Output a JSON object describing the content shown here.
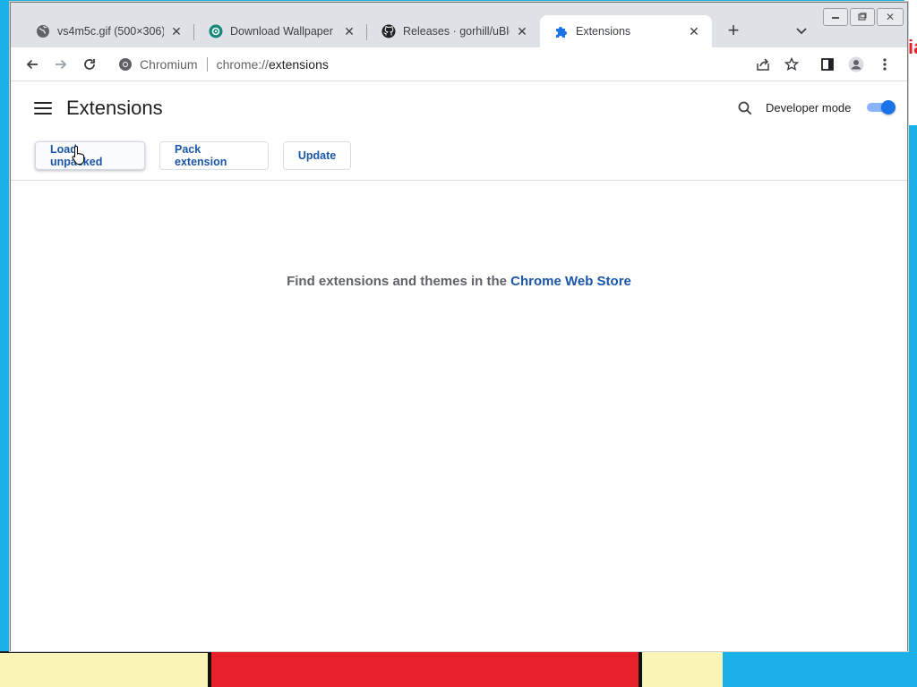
{
  "tabs": [
    {
      "title": "vs4m5c.gif (500×306)",
      "icon": "globe-icon"
    },
    {
      "title": "Download Wallpaper Engine",
      "icon": "wallpaper-engine-icon"
    },
    {
      "title": "Releases · gorhill/uBlock",
      "icon": "github-icon"
    },
    {
      "title": "Extensions",
      "icon": "puzzle-icon",
      "active": true
    }
  ],
  "omnibox": {
    "site_label": "Chromium",
    "url_scheme": "chrome://",
    "url_path": "extensions"
  },
  "page": {
    "title": "Extensions",
    "developer_mode_label": "Developer mode",
    "developer_mode_on": true,
    "buttons": {
      "load_unpacked": "Load unpacked",
      "pack_extension": "Pack extension",
      "update": "Update"
    },
    "empty_message_prefix": "Find extensions and themes in the ",
    "empty_message_link": "Chrome Web Store"
  },
  "colors": {
    "accent": "#1a73e8",
    "link": "#1a56a8",
    "tabstrip": "#dee1e6"
  }
}
